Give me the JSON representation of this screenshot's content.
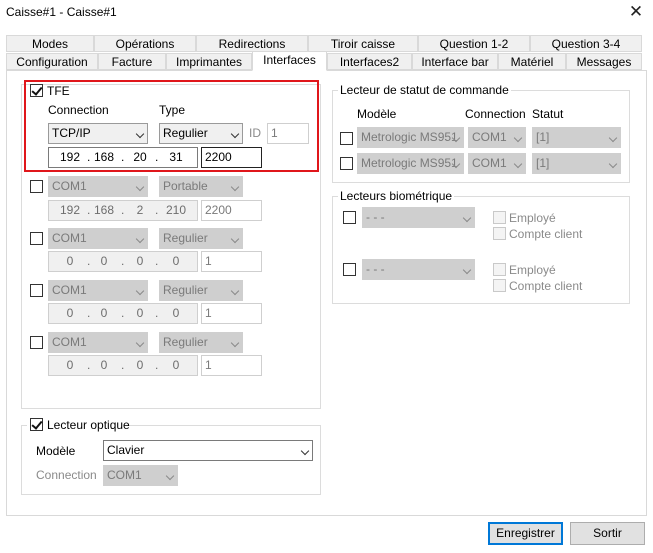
{
  "window": {
    "title": "Caisse#1 - Caisse#1",
    "close": "✕"
  },
  "tabs_row1": [
    "Modes",
    "Opérations",
    "Redirections",
    "Tiroir caisse",
    "Question 1-2",
    "Question 3-4"
  ],
  "tabs_row2": [
    "Configuration",
    "Facture",
    "Imprimantes",
    "Interfaces",
    "Interfaces2",
    "Interface bar",
    "Matériel",
    "Messages"
  ],
  "active_tab": "Interfaces",
  "tfe": {
    "label": "TFE",
    "checked": true,
    "connection_label": "Connection",
    "type_label": "Type",
    "id_label": "ID",
    "connection": "TCP/IP",
    "type": "Regulier",
    "id": "1",
    "ip": [
      "192",
      "168",
      "20",
      "31"
    ],
    "port": "2200"
  },
  "devices": [
    {
      "connection": "COM1",
      "type": "Portable",
      "ip": [
        "192",
        "168",
        "2",
        "210"
      ],
      "port": "2200"
    },
    {
      "connection": "COM1",
      "type": "Regulier",
      "ip": [
        "0",
        "0",
        "0",
        "0"
      ],
      "port": "1"
    },
    {
      "connection": "COM1",
      "type": "Regulier",
      "ip": [
        "0",
        "0",
        "0",
        "0"
      ],
      "port": "1"
    },
    {
      "connection": "COM1",
      "type": "Regulier",
      "ip": [
        "0",
        "0",
        "0",
        "0"
      ],
      "port": "1"
    }
  ],
  "optical": {
    "label": "Lecteur optique",
    "checked": true,
    "model_label": "Modèle",
    "model": "Clavier",
    "connection_label": "Connection",
    "connection": "COM1"
  },
  "status_reader": {
    "title": "Lecteur de statut de commande",
    "col_model": "Modèle",
    "col_connection": "Connection",
    "col_status": "Statut",
    "rows": [
      {
        "model": "Metrologic MS951",
        "connection": "COM1",
        "status": "[1]"
      },
      {
        "model": "Metrologic MS951",
        "connection": "COM1",
        "status": "[1]"
      }
    ]
  },
  "biometric": {
    "title": "Lecteurs biométrique",
    "rows": [
      {
        "model": "- - -",
        "employee": "Employé",
        "client": "Compte client"
      },
      {
        "model": "- - -",
        "employee": "Employé",
        "client": "Compte client"
      }
    ]
  },
  "buttons": {
    "save": "Enregistrer",
    "exit": "Sortir"
  }
}
